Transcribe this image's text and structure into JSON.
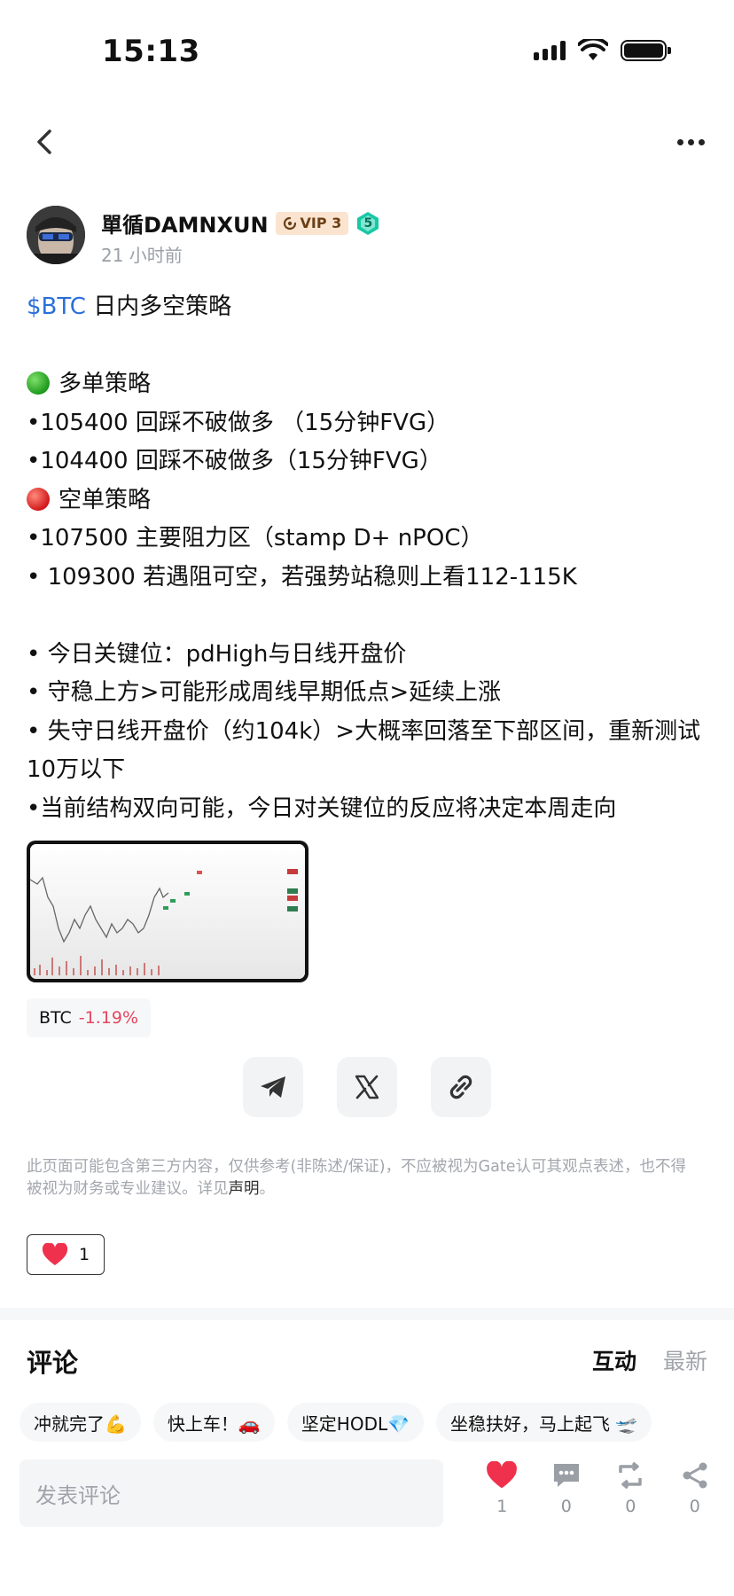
{
  "status_bar": {
    "time": "15:13"
  },
  "author": {
    "name": "單循DAMNXUN",
    "vip_label": "VIP 3",
    "level": "5",
    "time_ago": "21 小时前"
  },
  "post": {
    "ticker": "$BTC",
    "title_rest": " 日内多空策略",
    "long_heading": "多单策略",
    "long_items": [
      "•105400 回踩不破做多 （15分钟FVG）",
      "•104400 回踩不破做多（15分钟FVG）"
    ],
    "short_heading": "空单策略",
    "short_items": [
      "•107500 主要阻力区（stamp D+ nPOC）",
      "• 109300 若遇阻可空，若强势站稳则上看112-115K"
    ],
    "key_items": [
      "• 今日关键位：pdHigh与日线开盘价",
      "• 守稳上方>可能形成周线早期低点>延续上涨",
      "• 失守日线开盘价（约104k）>大概率回落至下部区间，重新测试10万以下",
      "•当前结构双向可能，今日对关键位的反应将决定本周走向"
    ]
  },
  "coin_tag": {
    "symbol": "BTC",
    "change": "-1.19%"
  },
  "share": {
    "telegram_icon": "telegram-icon",
    "x_icon": "x-icon",
    "link_icon": "link-icon"
  },
  "disclaimer": {
    "text": "此页面可能包含第三方内容，仅供参考(非陈述/保证)，不应被视为Gate认可其观点表述，也不得被视为财务或专业建议。详见",
    "link": "声明",
    "end": "。"
  },
  "like_pill": {
    "count": "1"
  },
  "comments": {
    "title": "评论",
    "tab_interactive": "互动",
    "tab_latest": "最新",
    "quick_replies": [
      "冲就完了💪",
      "快上车！🚗",
      "坚定HODL💎",
      "坐稳扶好，马上起飞 🛫"
    ],
    "input_placeholder": "发表评论"
  },
  "actions": {
    "like_count": "1",
    "comment_count": "0",
    "repost_count": "0",
    "share_count": "0"
  },
  "colors": {
    "ticker": "#2a6fdb",
    "negative": "#e5455e",
    "heart": "#f0314d",
    "vip_bg": "#fbe4cf",
    "level_badge": "#18c8a5"
  }
}
